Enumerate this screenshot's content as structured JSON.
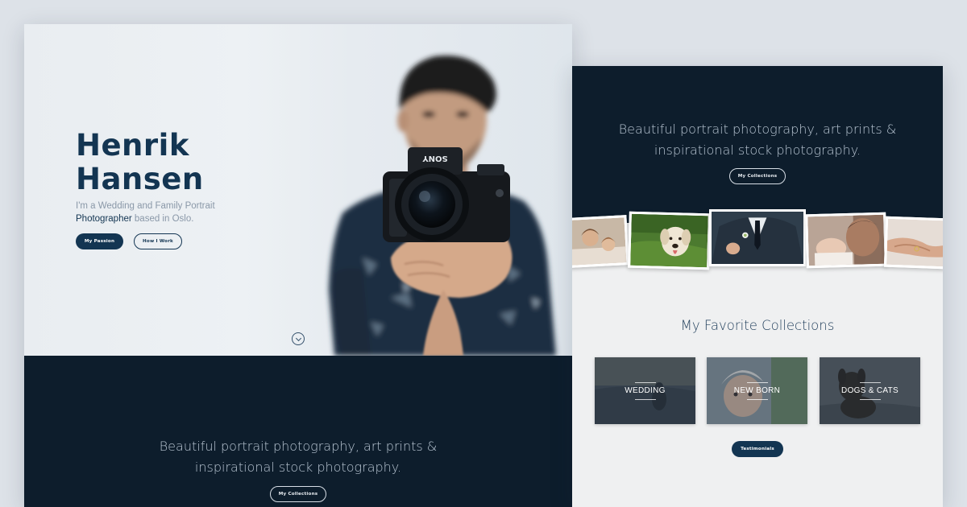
{
  "hero": {
    "name_line1": "Henrik",
    "name_line2": "Hansen",
    "intro_part1": "I'm a Wedding and Family Portrait",
    "intro_highlight": "Photographer",
    "intro_part2": " based in Oslo.",
    "primary_button": "My Passion",
    "secondary_button": "How I Work",
    "camera_brand": "SONY"
  },
  "tagline": {
    "line1": "Beautiful portrait photography, art prints &",
    "line2": "inspirational stock photography.",
    "button": "My Collections"
  },
  "collections": {
    "title": "My Favorite Collections",
    "items": [
      {
        "label": "WEDDING"
      },
      {
        "label": "NEW BORN"
      },
      {
        "label": "DOGS & CATS"
      }
    ],
    "testimonials_button": "Testimonials"
  },
  "colors": {
    "navy_dark": "#0d1d2c",
    "brand_blue": "#133552",
    "page_background": "#dde2e8",
    "light_section": "#eff0f1"
  },
  "icons": {
    "scroll_down": "chevron-down-circle-icon"
  }
}
